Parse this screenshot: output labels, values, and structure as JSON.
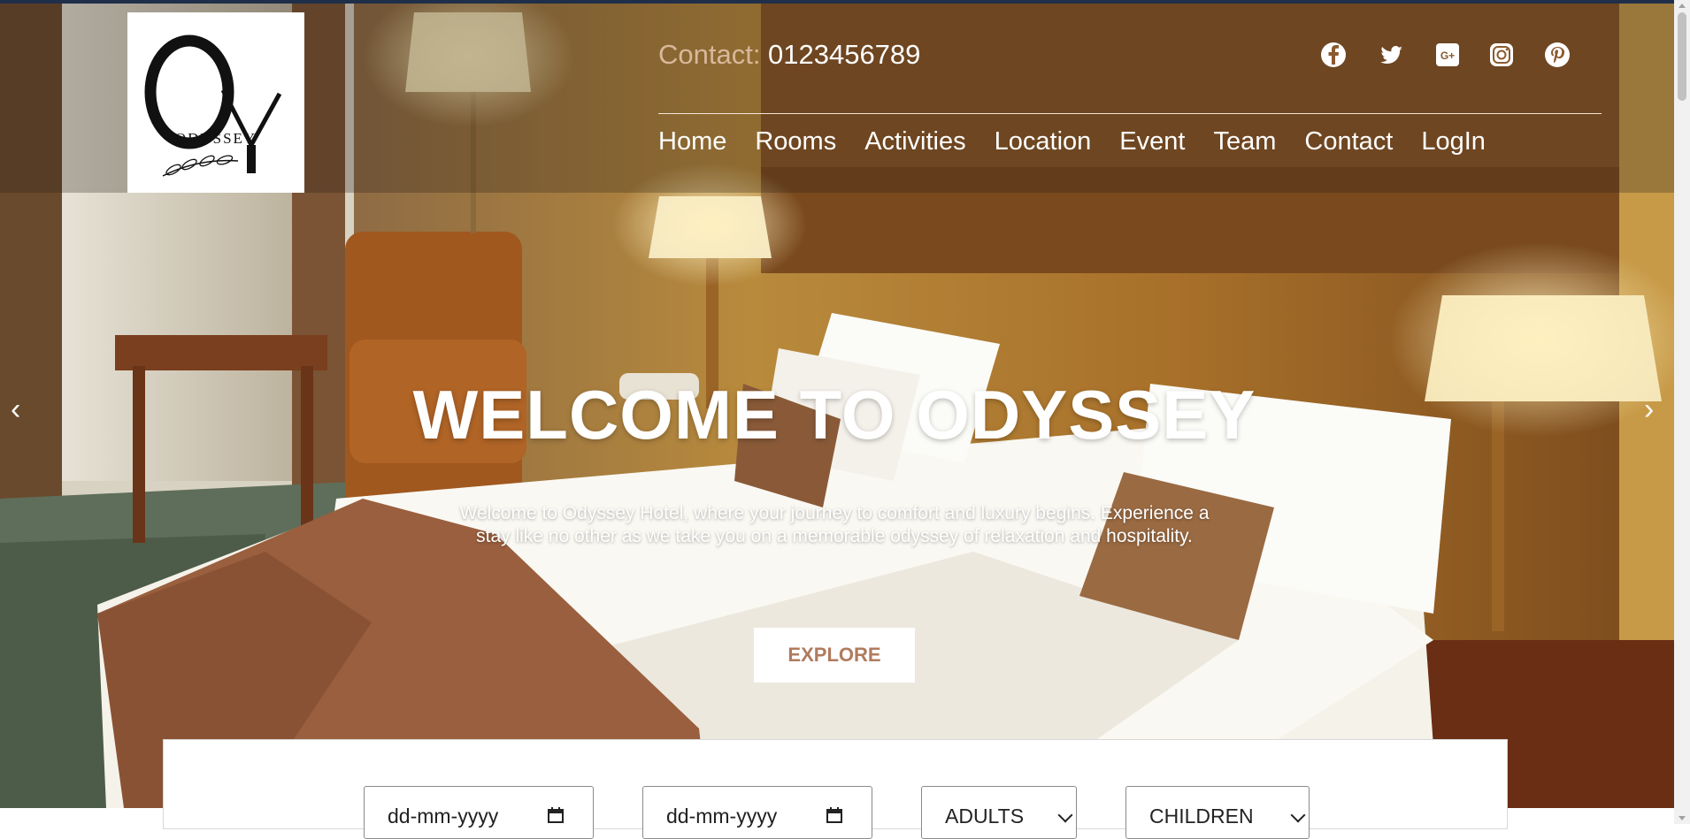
{
  "header": {
    "logo_text": "ODYSSEY",
    "contact_label": "Contact:",
    "contact_number": "0123456789",
    "social_icons": [
      "facebook-icon",
      "twitter-icon",
      "google-plus-icon",
      "instagram-icon",
      "pinterest-icon"
    ],
    "nav": [
      "Home",
      "Rooms",
      "Activities",
      "Location",
      "Event",
      "Team",
      "Contact",
      "LogIn"
    ]
  },
  "hero": {
    "title": "WELCOME TO ODYSSEY",
    "text": "Welcome to Odyssey Hotel, where your journey to comfort and luxury begins. Experience a stay like no other as we take you on a memorable odyssey of relaxation and hospitality.",
    "button": "EXPLORE",
    "prev_glyph": "‹",
    "next_glyph": "›"
  },
  "booking": {
    "checkin_placeholder": "dd-mm-yyyy",
    "checkout_placeholder": "dd-mm-yyyy",
    "adults_selected": "ADULTS",
    "children_selected": "CHILDREN"
  },
  "colors": {
    "accent": "#b07b5e",
    "contact_label": "#d9b89a",
    "top_strip": "#1f2f4a"
  }
}
